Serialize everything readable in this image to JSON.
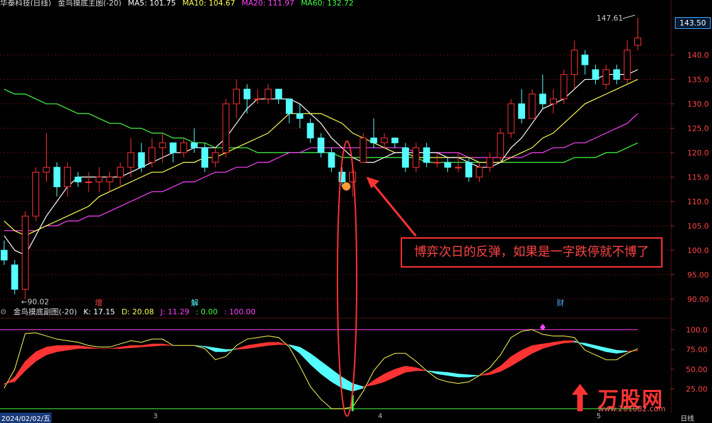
{
  "header": {
    "stock": "华泰科技(日线)",
    "indicator": "金鸟摸底主图(-20)",
    "ma5": "MA5: 101.75",
    "ma10": "MA10: 104.67",
    "ma20": "MA20: 111.97",
    "ma60": "MA60: 132.72"
  },
  "sub_header": {
    "indicator": "金鸟摸底副图(-20)",
    "k": "K: 17.15",
    "d": "D: 20.08",
    "j": "J: 11.29",
    "zero": ": 0.00",
    "hundred": ": 100.00"
  },
  "price_tag": "143.50",
  "high_label": "147.61",
  "low_label": "90.02",
  "callout_text": "博弈次日的反弹，如果是一字跌停就不博了",
  "markers": {
    "zeng": "增",
    "jie": "解",
    "cai": "财"
  },
  "bottom_axis": {
    "date": "2024/02/02/五",
    "m3": "3",
    "m4": "4",
    "m5": "5",
    "period": "日线"
  },
  "logo": {
    "brand": "万股网",
    "url": "www.201082.com"
  },
  "colors": {
    "up": "#ff3333",
    "down": "#55ffff",
    "ma5": "#ffffff",
    "ma10": "#ffff55",
    "ma20": "#ff44ff",
    "ma60": "#44ff44"
  },
  "chart_data": [
    {
      "type": "candlestick",
      "title": "金鸟摸底主图(-20)",
      "y_ticks": [
        90.0,
        95.0,
        100.0,
        105.0,
        110.0,
        115.0,
        120.0,
        125.0,
        130.0,
        135.0,
        140.0
      ],
      "ylim": [
        88,
        150
      ],
      "candles": [
        {
          "o": 100,
          "h": 102,
          "l": 97,
          "c": 98
        },
        {
          "o": 97,
          "h": 98,
          "l": 91,
          "c": 92
        },
        {
          "o": 92,
          "h": 108,
          "l": 90.02,
          "c": 107
        },
        {
          "o": 107,
          "h": 117,
          "l": 106,
          "c": 116
        },
        {
          "o": 116,
          "h": 124,
          "l": 114,
          "c": 117
        },
        {
          "o": 117,
          "h": 118,
          "l": 111,
          "c": 113
        },
        {
          "o": 113,
          "h": 118,
          "l": 111,
          "c": 117
        },
        {
          "o": 115,
          "h": 116,
          "l": 113,
          "c": 114
        },
        {
          "o": 114,
          "h": 116,
          "l": 112,
          "c": 114
        },
        {
          "o": 114,
          "h": 117,
          "l": 112,
          "c": 115
        },
        {
          "o": 114,
          "h": 116,
          "l": 112,
          "c": 115
        },
        {
          "o": 115,
          "h": 118,
          "l": 113,
          "c": 117
        },
        {
          "o": 117,
          "h": 123,
          "l": 115,
          "c": 120
        },
        {
          "o": 120,
          "h": 122,
          "l": 116,
          "c": 117
        },
        {
          "o": 118,
          "h": 123,
          "l": 117,
          "c": 121
        },
        {
          "o": 121,
          "h": 124,
          "l": 118,
          "c": 122
        },
        {
          "o": 122,
          "h": 122,
          "l": 118,
          "c": 120
        },
        {
          "o": 120,
          "h": 123,
          "l": 119,
          "c": 122
        },
        {
          "o": 122,
          "h": 125,
          "l": 120,
          "c": 121
        },
        {
          "o": 121,
          "h": 122,
          "l": 116,
          "c": 117
        },
        {
          "o": 118,
          "h": 121,
          "l": 117,
          "c": 120
        },
        {
          "o": 120,
          "h": 131,
          "l": 119,
          "c": 130
        },
        {
          "o": 130,
          "h": 135,
          "l": 127,
          "c": 133
        },
        {
          "o": 133,
          "h": 134,
          "l": 128,
          "c": 131
        },
        {
          "o": 131,
          "h": 133,
          "l": 130,
          "c": 131
        },
        {
          "o": 131,
          "h": 134,
          "l": 130,
          "c": 133
        },
        {
          "o": 133,
          "h": 133,
          "l": 130,
          "c": 131
        },
        {
          "o": 131,
          "h": 131,
          "l": 126,
          "c": 128
        },
        {
          "o": 128,
          "h": 130,
          "l": 125,
          "c": 127
        },
        {
          "o": 126,
          "h": 127,
          "l": 122,
          "c": 123
        },
        {
          "o": 123,
          "h": 124,
          "l": 119,
          "c": 120
        },
        {
          "o": 120,
          "h": 121,
          "l": 116,
          "c": 117
        },
        {
          "o": 116,
          "h": 117,
          "l": 113,
          "c": 114
        },
        {
          "o": 114,
          "h": 117,
          "l": 111,
          "c": 116
        },
        {
          "o": 118,
          "h": 124,
          "l": 118,
          "c": 123
        },
        {
          "o": 123,
          "h": 127,
          "l": 121,
          "c": 122
        },
        {
          "o": 122,
          "h": 124,
          "l": 121,
          "c": 123
        },
        {
          "o": 123,
          "h": 123,
          "l": 121,
          "c": 122
        },
        {
          "o": 121,
          "h": 122,
          "l": 116,
          "c": 117
        },
        {
          "o": 117,
          "h": 122,
          "l": 116,
          "c": 121
        },
        {
          "o": 121,
          "h": 122,
          "l": 117,
          "c": 118
        },
        {
          "o": 118,
          "h": 120,
          "l": 117,
          "c": 118
        },
        {
          "o": 118,
          "h": 119,
          "l": 116,
          "c": 117
        },
        {
          "o": 117,
          "h": 120,
          "l": 116,
          "c": 117
        },
        {
          "o": 118,
          "h": 119,
          "l": 114,
          "c": 115
        },
        {
          "o": 115,
          "h": 118,
          "l": 114,
          "c": 117
        },
        {
          "o": 117,
          "h": 120,
          "l": 116,
          "c": 119
        },
        {
          "o": 119,
          "h": 125,
          "l": 118,
          "c": 124
        },
        {
          "o": 124,
          "h": 131,
          "l": 123,
          "c": 130
        },
        {
          "o": 130,
          "h": 133,
          "l": 126,
          "c": 127
        },
        {
          "o": 127,
          "h": 133,
          "l": 127,
          "c": 132
        },
        {
          "o": 132,
          "h": 136,
          "l": 129,
          "c": 130
        },
        {
          "o": 130,
          "h": 133,
          "l": 128,
          "c": 131
        },
        {
          "o": 131,
          "h": 137,
          "l": 130,
          "c": 136
        },
        {
          "o": 136,
          "h": 143,
          "l": 133,
          "c": 141
        },
        {
          "o": 140,
          "h": 141,
          "l": 136,
          "c": 138
        },
        {
          "o": 137,
          "h": 138,
          "l": 134,
          "c": 135
        },
        {
          "o": 134,
          "h": 138,
          "l": 133,
          "c": 137
        },
        {
          "o": 137,
          "h": 138,
          "l": 134,
          "c": 135
        },
        {
          "o": 135,
          "h": 143,
          "l": 134,
          "c": 141
        },
        {
          "o": 142,
          "h": 147.61,
          "l": 141,
          "c": 143.5
        }
      ],
      "ma5": [
        103,
        100,
        99,
        103,
        107,
        110,
        113,
        115,
        115,
        115,
        115,
        115,
        116,
        117,
        118,
        119,
        120,
        120,
        121,
        121,
        121,
        123,
        126,
        129,
        131,
        131,
        131,
        131,
        130,
        128,
        126,
        123,
        121,
        119,
        118,
        118,
        119,
        120,
        120,
        120,
        120,
        120,
        119,
        119,
        118,
        117,
        117,
        118,
        121,
        123,
        126,
        129,
        130,
        131,
        133,
        135,
        135,
        136,
        136,
        136,
        137
      ],
      "ma10": [
        106,
        104,
        103,
        104,
        105,
        106,
        107,
        108,
        109,
        111,
        112,
        113,
        114,
        115,
        116,
        116,
        117,
        118,
        118,
        119,
        119,
        120,
        121,
        122,
        123,
        124,
        126,
        128,
        128,
        128,
        128,
        127,
        126,
        124,
        123,
        122,
        121,
        120,
        120,
        119,
        119,
        119,
        119,
        119,
        119,
        118,
        118,
        118,
        119,
        120,
        121,
        123,
        124,
        126,
        128,
        130,
        131,
        132,
        133,
        134,
        135
      ],
      "ma20": [
        104,
        104,
        104,
        104,
        105,
        105,
        106,
        106,
        107,
        107,
        108,
        109,
        110,
        111,
        112,
        112,
        113,
        114,
        114,
        115,
        116,
        116,
        117,
        117,
        118,
        118,
        119,
        120,
        120,
        121,
        121,
        121,
        121,
        121,
        121,
        121,
        121,
        121,
        121,
        120,
        120,
        120,
        120,
        120,
        119,
        119,
        119,
        119,
        119,
        119,
        120,
        120,
        121,
        121,
        122,
        122,
        123,
        124,
        125,
        126,
        128
      ],
      "ma60": [
        133,
        132,
        132,
        131,
        130,
        130,
        129,
        128,
        128,
        127,
        126,
        126,
        125,
        125,
        124,
        124,
        123,
        123,
        122,
        122,
        121,
        121,
        121,
        121,
        120,
        120,
        120,
        120,
        120,
        120,
        120,
        120,
        119,
        119,
        119,
        119,
        119,
        119,
        119,
        119,
        118,
        118,
        118,
        118,
        118,
        118,
        118,
        118,
        118,
        118,
        118,
        118,
        118,
        118,
        119,
        119,
        119,
        120,
        120,
        121,
        122
      ]
    },
    {
      "type": "line",
      "title": "金鸟摸底副图(-20)",
      "y_ticks": [
        25.0,
        50.0,
        75.0,
        100.0
      ],
      "ylim": [
        -5,
        115
      ],
      "k": [
        30,
        40,
        60,
        72,
        78,
        80,
        80,
        80,
        78,
        76,
        76,
        78,
        80,
        80,
        82,
        82,
        80,
        80,
        80,
        78,
        72,
        72,
        76,
        80,
        82,
        84,
        84,
        80,
        70,
        56,
        44,
        34,
        26,
        22,
        26,
        36,
        44,
        50,
        54,
        52,
        48,
        44,
        42,
        40,
        40,
        42,
        46,
        54,
        66,
        74,
        80,
        82,
        84,
        86,
        86,
        80,
        76,
        72,
        70,
        72,
        74
      ],
      "d": [
        32,
        34,
        48,
        60,
        68,
        72,
        74,
        76,
        76,
        76,
        76,
        76,
        77,
        78,
        79,
        80,
        80,
        80,
        80,
        79,
        77,
        75,
        75,
        76,
        78,
        80,
        81,
        81,
        78,
        70,
        60,
        50,
        40,
        32,
        28,
        30,
        34,
        40,
        46,
        48,
        48,
        47,
        46,
        44,
        43,
        42,
        43,
        47,
        54,
        62,
        70,
        76,
        80,
        83,
        84,
        83,
        80,
        77,
        74,
        73,
        73
      ],
      "j": [
        26,
        50,
        95,
        96,
        92,
        88,
        86,
        84,
        80,
        78,
        78,
        82,
        86,
        84,
        88,
        88,
        80,
        80,
        80,
        76,
        62,
        66,
        80,
        88,
        90,
        92,
        90,
        78,
        54,
        28,
        12,
        0,
        0,
        2,
        22,
        48,
        64,
        70,
        70,
        60,
        48,
        38,
        34,
        32,
        34,
        42,
        52,
        68,
        90,
        98,
        100,
        94,
        92,
        92,
        90,
        74,
        68,
        62,
        62,
        70,
        76
      ]
    }
  ]
}
